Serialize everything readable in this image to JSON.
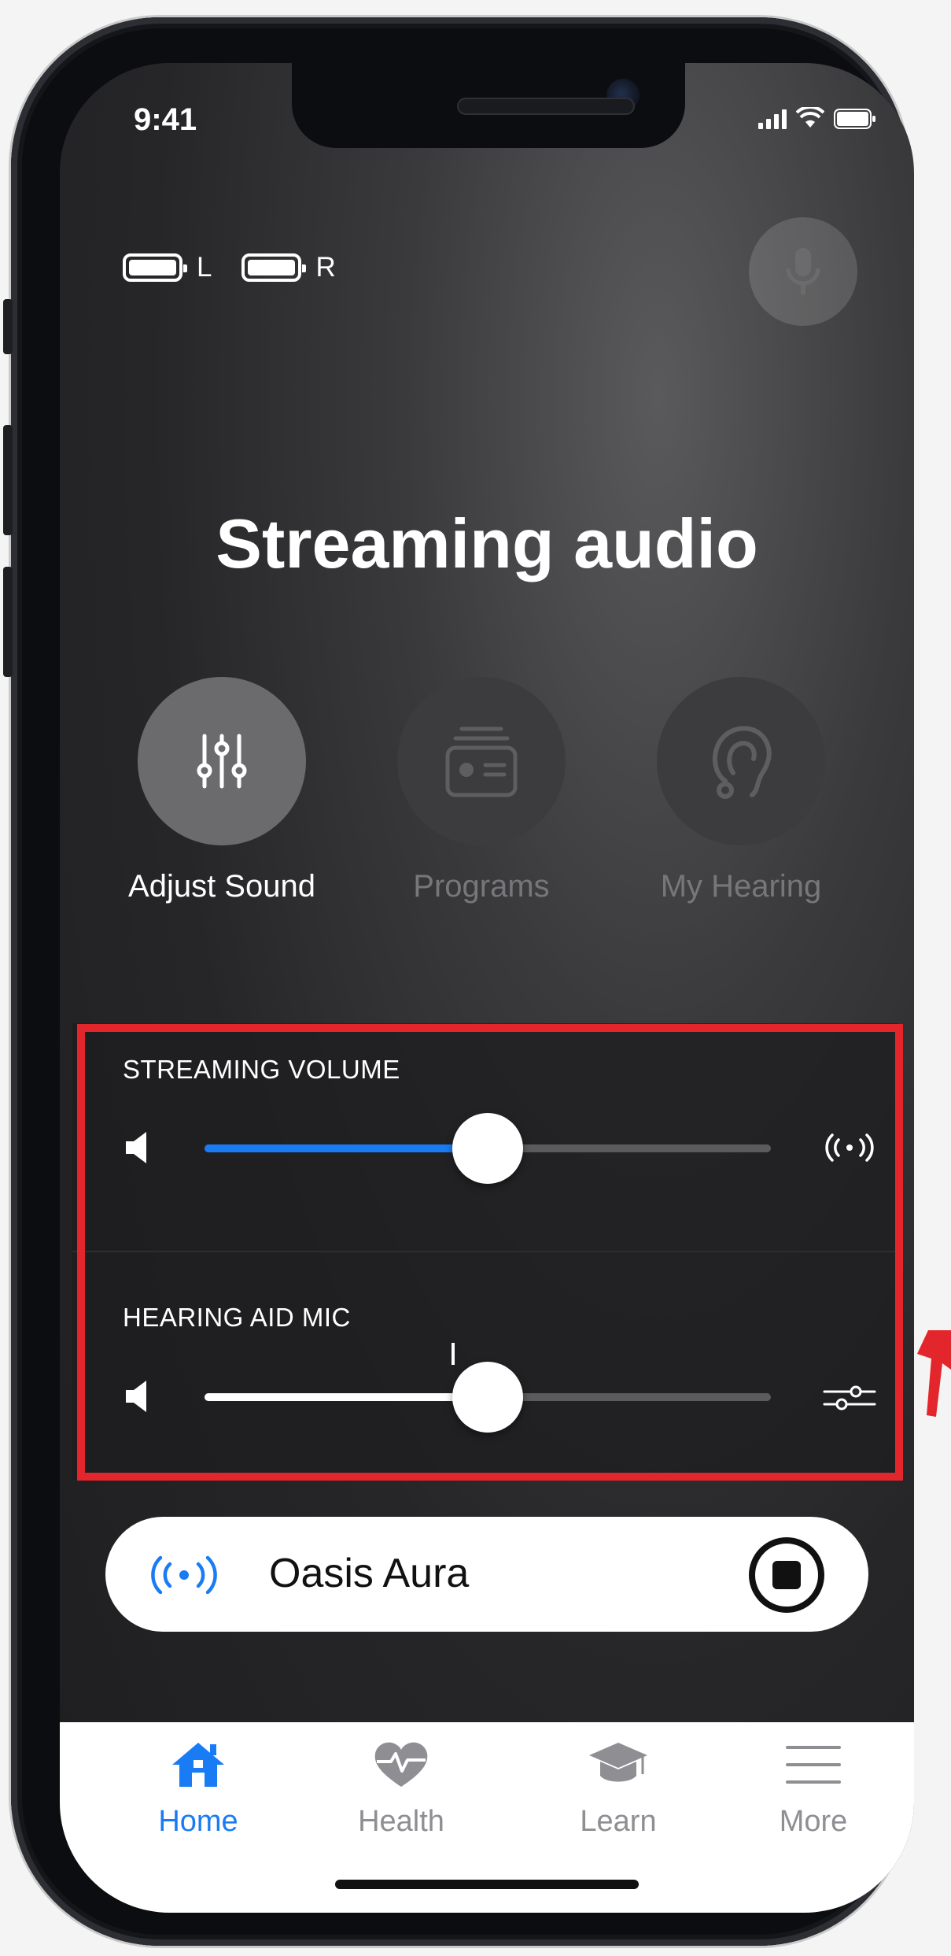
{
  "status_bar": {
    "time": "9:41"
  },
  "battery": {
    "left_label": "L",
    "right_label": "R"
  },
  "mic_button_icon": "microphone-icon",
  "title": "Streaming audio",
  "actions": [
    {
      "label": "Adjust Sound",
      "icon": "equalizer-sliders-icon",
      "state": "active"
    },
    {
      "label": "Programs",
      "icon": "programs-card-icon",
      "state": "inactive"
    },
    {
      "label": "My Hearing",
      "icon": "hearing-aid-ear-icon",
      "state": "inactive"
    }
  ],
  "streaming_volume": {
    "label": "STREAMING VOLUME",
    "level": 0.5,
    "fill_color": "#1a7cf5"
  },
  "hearing_aid_mic": {
    "label": "HEARING AID MIC",
    "level": 0.5,
    "fill_color": "#ffffff"
  },
  "stream_source": {
    "name": "Oasis Aura",
    "icon": "broadcast-icon",
    "action_icon": "stop-icon"
  },
  "tabs": [
    {
      "label": "Home",
      "icon": "home-icon",
      "active": true
    },
    {
      "label": "Health",
      "icon": "heart-pulse-icon",
      "active": false
    },
    {
      "label": "Learn",
      "icon": "graduation-cap-icon",
      "active": false
    },
    {
      "label": "More",
      "icon": "menu-icon",
      "active": false
    }
  ],
  "colors": {
    "accent": "#1a7cf5",
    "highlight": "#e3262b",
    "inactive": "#8e8e93"
  }
}
